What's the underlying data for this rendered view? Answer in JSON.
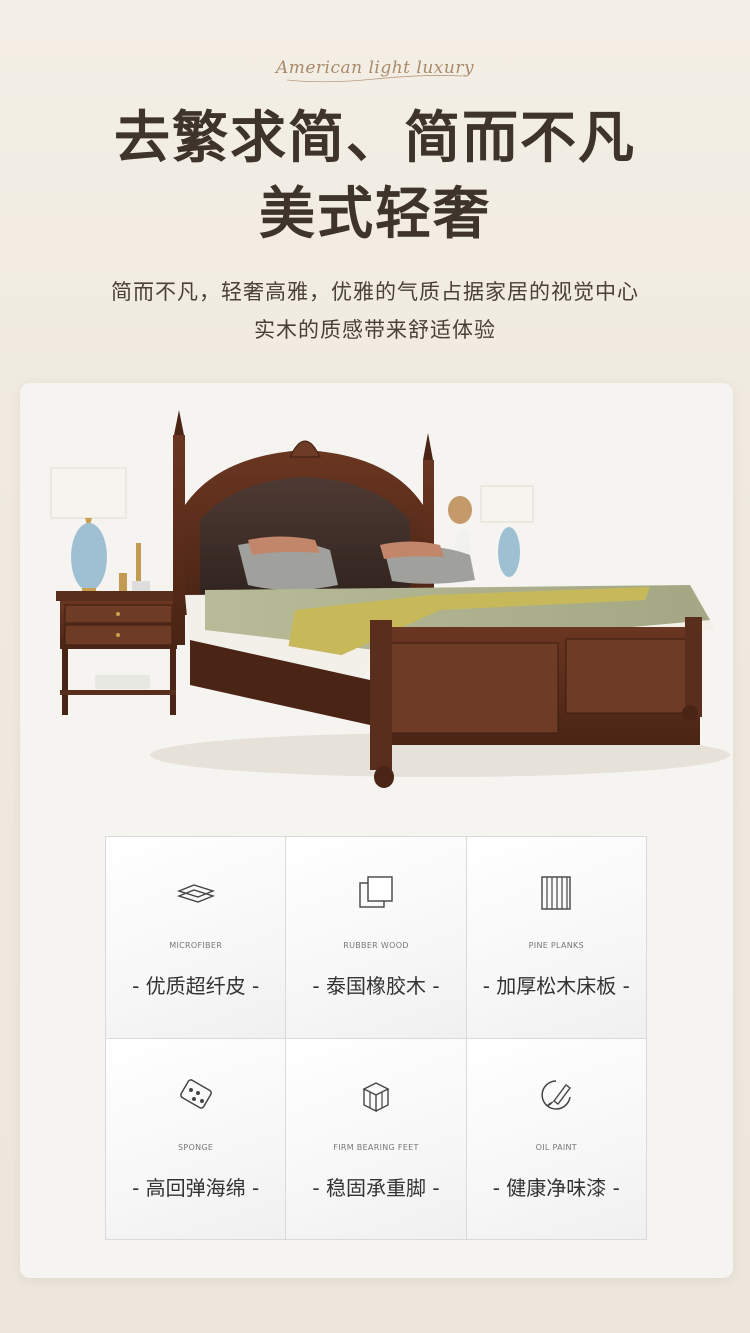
{
  "header": {
    "script_text": "American light luxury",
    "headline_line1": "去繁求简、简而不凡",
    "headline_line2": "美式轻奢",
    "subtitle_line1": "简而不凡，轻奢高雅，优雅的气质占据家居的视觉中心",
    "subtitle_line2": "实木的质感带来舒适体验"
  },
  "features": [
    {
      "icon": "microfiber-layers-icon",
      "en": "MICROFIBER",
      "cn": "- 优质超纤皮 -"
    },
    {
      "icon": "rubber-wood-icon",
      "en": "RUBBER WOOD",
      "cn": "- 泰国橡胶木 -"
    },
    {
      "icon": "pine-planks-icon",
      "en": "PINE PLANKS",
      "cn": "- 加厚松木床板 -"
    },
    {
      "icon": "sponge-icon",
      "en": "SPONGE",
      "cn": "- 高回弹海绵 -"
    },
    {
      "icon": "bearing-feet-icon",
      "en": "FIRM BEARING FEET",
      "cn": "- 稳固承重脚 -"
    },
    {
      "icon": "oil-paint-icon",
      "en": "OIL PAINT",
      "cn": "- 健康净味漆 -"
    }
  ],
  "colors": {
    "headline": "#3e342b",
    "wood": "#5a2e1c",
    "background": "#f1ece3"
  }
}
